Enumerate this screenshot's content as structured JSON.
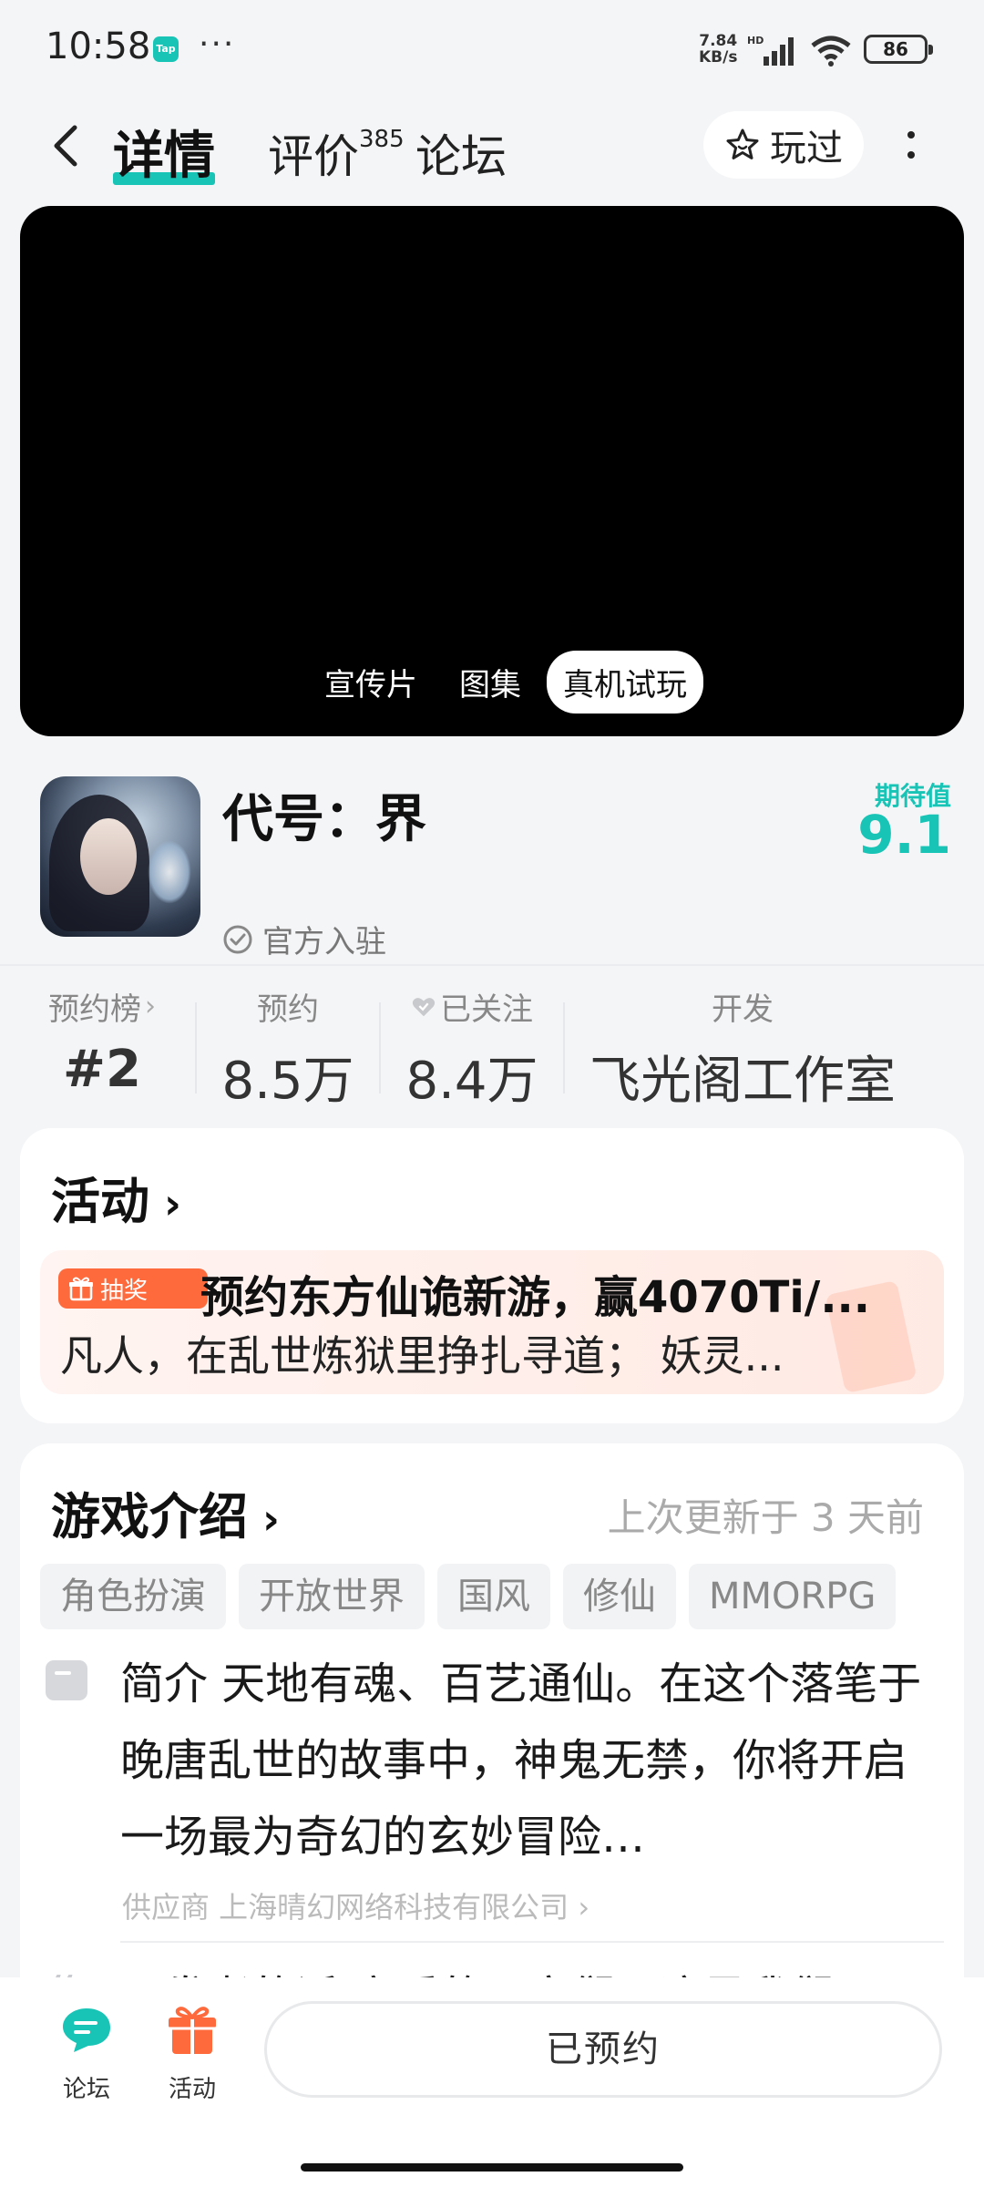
{
  "status_bar": {
    "time": "10:58",
    "badge": "Tap",
    "dots": "···",
    "net_speed_value": "7.84",
    "net_speed_unit": "KB/s",
    "net_type": "HD",
    "battery": "86"
  },
  "nav": {
    "tab_detail": "详情",
    "tab_review": "评价",
    "review_count": "385",
    "tab_forum": "论坛",
    "played_label": "玩过"
  },
  "media": {
    "options": [
      "宣传片",
      "图集",
      "真机试玩"
    ],
    "active": "真机试玩"
  },
  "game": {
    "name": "代号：界",
    "official_label": "官方入驻",
    "expect_label": "期待值",
    "expect_value": "9.1"
  },
  "stats": [
    {
      "label": "预约榜",
      "value": "#2"
    },
    {
      "label": "预约",
      "value": "8.5万"
    },
    {
      "label": "已关注",
      "value": "8.4万"
    },
    {
      "label": "开发",
      "value": "飞光阁工作室"
    }
  ],
  "activity": {
    "title": "活动",
    "badge": "抽奖",
    "banner_title": "预约东方仙诡新游，赢4070Ti/...",
    "banner_desc": "凡人，在乱世炼狱里挣扎寻道； 妖灵..."
  },
  "intro": {
    "title": "游戏介绍",
    "updated": "上次更新于 3 天前",
    "tags": [
      "角色扮演",
      "开放世界",
      "国风",
      "修仙",
      "MMORPG"
    ],
    "text": "简介 天地有魂、百艺通仙。在这个落笔于晚唐乱世的故事中，神鬼无禁，你将开启一场最为奇幻的玄妙冒险…",
    "supplier": "供应商 上海晴幻网络科技有限公司",
    "next_preview": "开发者的话 亲爱的玩家们，这是我们..."
  },
  "bottom_bar": {
    "forum": "论坛",
    "activity": "活动",
    "reserved_button": "已预约"
  },
  "colors": {
    "accent": "#18c4b6",
    "activity_orange": "#ff6a3d",
    "background": "#f4f5f7"
  }
}
